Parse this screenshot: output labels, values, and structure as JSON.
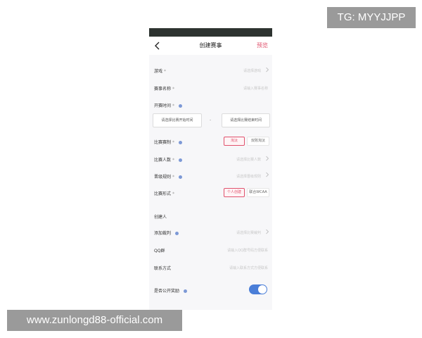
{
  "watermarks": {
    "tg": "TG: MYYJJPP",
    "url": "www.zunlongd88-official.com"
  },
  "nav": {
    "title": "创建赛事",
    "preview": "预览"
  },
  "form": {
    "game": {
      "label": "游戏",
      "required": "*",
      "placeholder": "请选择游戏"
    },
    "name": {
      "label": "赛事名称",
      "required": "*",
      "placeholder": "请输入赛事名称"
    },
    "time": {
      "label": "开赛时间",
      "required": "*",
      "start": "请选择比赛开始时间",
      "separator": "-",
      "end": "请选择比赛结束时间"
    },
    "format": {
      "label": "比赛赛制",
      "required": "*",
      "options": [
        "淘汰",
        "双败淘汰"
      ],
      "selected": "淘汰"
    },
    "players": {
      "label": "比赛人数",
      "required": "*",
      "placeholder": "请选择比赛人数"
    },
    "advance": {
      "label": "晋级规则",
      "required": "*",
      "placeholder": "请选择晋级规则"
    },
    "mode": {
      "label": "比赛形式",
      "required": "*",
      "options": [
        "个人创建",
        "联合WCAA"
      ],
      "selected": "个人创建"
    },
    "creator": {
      "label": "创建人"
    },
    "referee": {
      "label": "添加裁判",
      "placeholder": "请选择比赛裁判"
    },
    "qq": {
      "label": "QQ群",
      "placeholder": "请输入QQ群号码方便联系"
    },
    "contact": {
      "label": "联系方式",
      "placeholder": "请输入联系方式方便联系"
    },
    "public_reward": {
      "label": "是否公开奖励",
      "enabled": true
    }
  },
  "colors": {
    "accent": "#e0526d",
    "toggle": "#4a7ed8",
    "info_dot": "#7d99d6",
    "status_bar": "#2d3330"
  },
  "icons": {
    "back": "chevron-left-icon",
    "row": "chevron-right-icon",
    "info": "info-dot-icon"
  }
}
